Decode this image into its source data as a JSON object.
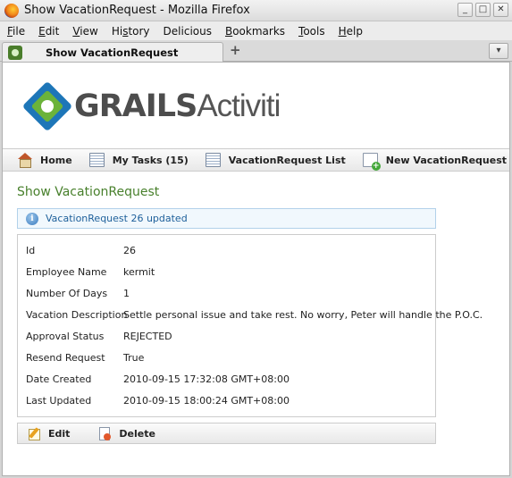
{
  "window": {
    "title": "Show VacationRequest - Mozilla Firefox",
    "minimize": "_",
    "maximize": "□",
    "close": "✕"
  },
  "menu": {
    "file": {
      "u": "F",
      "rest": "ile"
    },
    "edit": {
      "u": "E",
      "rest": "dit"
    },
    "view": {
      "u": "V",
      "rest": "iew"
    },
    "history": {
      "pre": "Hi",
      "u": "s",
      "rest": "tory"
    },
    "delicious": {
      "u": "D",
      "rest": "elicious"
    },
    "bookmarks": {
      "u": "B",
      "rest": "ookmarks"
    },
    "tools": {
      "u": "T",
      "rest": "ools"
    },
    "help": {
      "u": "H",
      "rest": "elp"
    }
  },
  "tab": {
    "label": "Show VacationRequest",
    "new_tab": "+"
  },
  "logo": {
    "bold": "GRAILS",
    "light": "Activiti"
  },
  "nav": {
    "home": "Home",
    "my_tasks": "My Tasks (15)",
    "list": "VacationRequest List",
    "create": "New VacationRequest"
  },
  "page": {
    "heading": "Show VacationRequest",
    "message": "VacationRequest 26 updated",
    "info_glyph": "i"
  },
  "properties": [
    {
      "name": "Id",
      "value": "26"
    },
    {
      "name": "Employee Name",
      "value": "kermit"
    },
    {
      "name": "Number Of Days",
      "value": "1"
    },
    {
      "name": "Vacation Description",
      "value": "Settle personal issue and take rest. No worry, Peter will handle the P.O.C."
    },
    {
      "name": "Approval Status",
      "value": "REJECTED"
    },
    {
      "name": "Resend Request",
      "value": "True"
    },
    {
      "name": "Date Created",
      "value": "2010-09-15 17:32:08 GMT+08:00"
    },
    {
      "name": "Last Updated",
      "value": "2010-09-15 18:00:24 GMT+08:00"
    }
  ],
  "buttons": {
    "edit": "Edit",
    "delete": "Delete"
  }
}
